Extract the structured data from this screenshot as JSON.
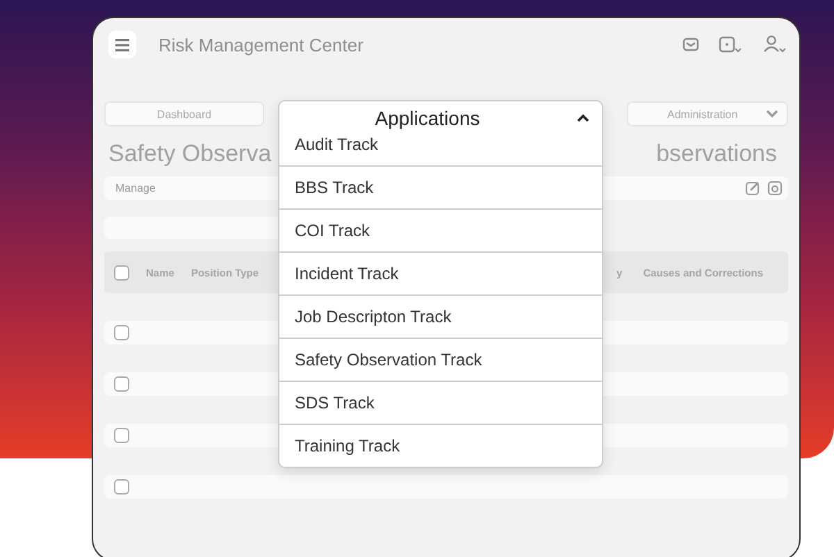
{
  "window": {
    "title": "Risk Management Center"
  },
  "nav": {
    "left": "Dashboard",
    "right": "Administration"
  },
  "heading": {
    "left": "Safety Observa",
    "right": "bservations"
  },
  "manage_bar": {
    "label": "Manage"
  },
  "table": {
    "header_checked": false,
    "columns": [
      {
        "label": "Name"
      },
      {
        "label": "Position Type"
      },
      {
        "label": "y"
      },
      {
        "label": "Causes and Corrections"
      }
    ],
    "rows": [
      {
        "checked": false
      },
      {
        "checked": false
      },
      {
        "checked": false
      },
      {
        "checked": false
      }
    ]
  },
  "dropdown": {
    "label": "Applications",
    "expanded": true,
    "items": [
      {
        "label": "Audit Track"
      },
      {
        "label": "BBS Track"
      },
      {
        "label": "COI Track"
      },
      {
        "label": "Incident Track"
      },
      {
        "label": "Job Descripton Track"
      },
      {
        "label": "Safety Observation Track"
      },
      {
        "label": "SDS Track"
      },
      {
        "label": "Training Track"
      }
    ]
  }
}
